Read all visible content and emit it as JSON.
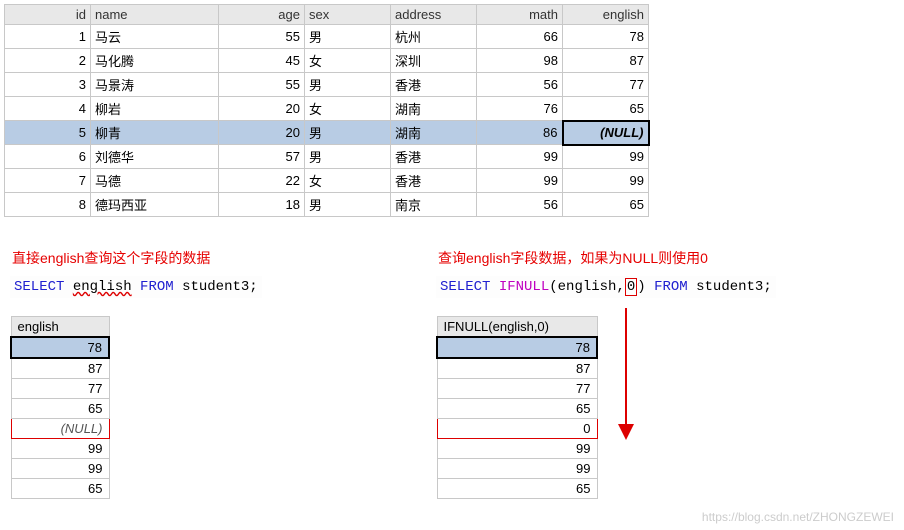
{
  "columns": {
    "id": "id",
    "name": "name",
    "age": "age",
    "sex": "sex",
    "address": "address",
    "math": "math",
    "english": "english"
  },
  "rows": [
    {
      "id": "1",
      "name": "马云",
      "age": "55",
      "sex": "男",
      "address": "杭州",
      "math": "66",
      "english": "78"
    },
    {
      "id": "2",
      "name": "马化腾",
      "age": "45",
      "sex": "女",
      "address": "深圳",
      "math": "98",
      "english": "87"
    },
    {
      "id": "3",
      "name": "马景涛",
      "age": "55",
      "sex": "男",
      "address": "香港",
      "math": "56",
      "english": "77"
    },
    {
      "id": "4",
      "name": "柳岩",
      "age": "20",
      "sex": "女",
      "address": "湖南",
      "math": "76",
      "english": "65"
    },
    {
      "id": "5",
      "name": "柳青",
      "age": "20",
      "sex": "男",
      "address": "湖南",
      "math": "86",
      "english": "(NULL)"
    },
    {
      "id": "6",
      "name": "刘德华",
      "age": "57",
      "sex": "男",
      "address": "香港",
      "math": "99",
      "english": "99"
    },
    {
      "id": "7",
      "name": "马德",
      "age": "22",
      "sex": "女",
      "address": "香港",
      "math": "99",
      "english": "99"
    },
    {
      "id": "8",
      "name": "德玛西亚",
      "age": "18",
      "sex": "男",
      "address": "南京",
      "math": "56",
      "english": "65"
    }
  ],
  "left": {
    "caption": "直接english查询这个字段的数据",
    "sql": {
      "kw1": "SELECT",
      "col": "english",
      "kw2": "FROM",
      "tbl": "student3;"
    },
    "header": "english",
    "values": [
      "78",
      "87",
      "77",
      "65",
      "(NULL)",
      "99",
      "99",
      "65"
    ]
  },
  "right": {
    "caption": "查询english字段数据，如果为NULL则使用0",
    "sql": {
      "kw1": "SELECT",
      "fn": "IFNULL",
      "open": "(english,",
      "zero": "0",
      "close": ")",
      "kw2": "FROM",
      "tbl": "student3;"
    },
    "header": "IFNULL(english,0)",
    "values": [
      "78",
      "87",
      "77",
      "65",
      "0",
      "99",
      "99",
      "65"
    ]
  },
  "watermark": "https://blog.csdn.net/ZHONGZEWEI",
  "chart_data": {
    "type": "table",
    "title": "student3",
    "columns": [
      "id",
      "name",
      "age",
      "sex",
      "address",
      "math",
      "english"
    ],
    "rows": [
      [
        1,
        "马云",
        55,
        "男",
        "杭州",
        66,
        78
      ],
      [
        2,
        "马化腾",
        45,
        "女",
        "深圳",
        98,
        87
      ],
      [
        3,
        "马景涛",
        55,
        "男",
        "香港",
        56,
        77
      ],
      [
        4,
        "柳岩",
        20,
        "女",
        "湖南",
        76,
        65
      ],
      [
        5,
        "柳青",
        20,
        "男",
        "湖南",
        86,
        null
      ],
      [
        6,
        "刘德华",
        57,
        "男",
        "香港",
        99,
        99
      ],
      [
        7,
        "马德",
        22,
        "女",
        "香港",
        99,
        99
      ],
      [
        8,
        "德玛西亚",
        18,
        "男",
        "南京",
        56,
        65
      ]
    ]
  }
}
